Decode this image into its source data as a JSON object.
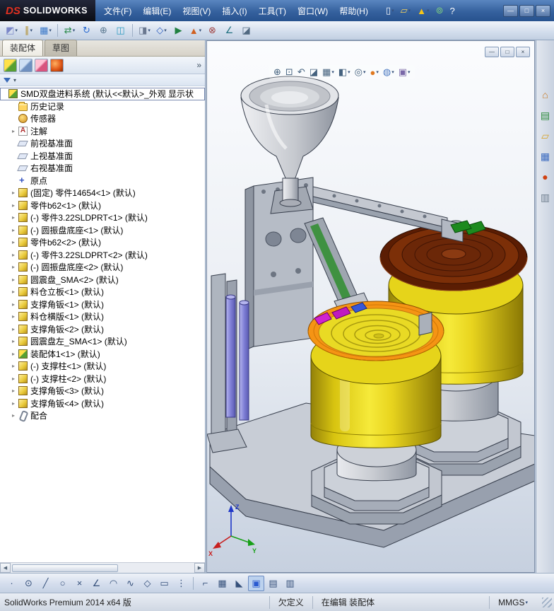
{
  "titlebar": {
    "brand_mark": "DS",
    "brand": "SOLIDWORKS",
    "menus": [
      {
        "label": "文件(F)"
      },
      {
        "label": "编辑(E)"
      },
      {
        "label": "视图(V)"
      },
      {
        "label": "插入(I)"
      },
      {
        "label": "工具(T)"
      },
      {
        "label": "窗口(W)"
      },
      {
        "label": "帮助(H)"
      }
    ],
    "tools": [
      {
        "name": "new-document-icon",
        "glyph": "▯",
        "color": "#f4f7fb",
        "arrow": true
      },
      {
        "name": "open-icon",
        "glyph": "▱",
        "color": "#f5d35c",
        "arrow": true
      },
      {
        "name": "alert-icon",
        "glyph": "▲",
        "color": "#f5c518",
        "arrow": true
      },
      {
        "name": "connect-icon",
        "glyph": "⊚",
        "color": "#7fd07f"
      },
      {
        "name": "help-icon",
        "glyph": "?",
        "color": "#ffffff"
      }
    ],
    "window_buttons": [
      {
        "name": "minimize-button",
        "glyph": "—"
      },
      {
        "name": "maximize-button",
        "glyph": "□"
      },
      {
        "name": "close-button",
        "glyph": "×"
      }
    ]
  },
  "toolbar": {
    "items": [
      {
        "name": "insert-component-icon",
        "glyph": "◩",
        "color": "#7a86c8",
        "arrow": true
      },
      {
        "name": "mate-icon",
        "glyph": "∥",
        "color": "#b08c28",
        "arrow": true
      },
      {
        "name": "linear-pattern-icon",
        "glyph": "▦",
        "color": "#3a78c8",
        "arrow": true
      },
      {
        "sep": true
      },
      {
        "name": "move-component-icon",
        "glyph": "⇄",
        "color": "#2a8a4a",
        "arrow": true
      },
      {
        "name": "rotate-component-icon",
        "glyph": "↻",
        "color": "#2a6ad0"
      },
      {
        "name": "smart-fasteners-icon",
        "glyph": "⊕",
        "color": "#5a7890"
      },
      {
        "name": "show-hidden-components-icon",
        "glyph": "◫",
        "color": "#2a9ac0"
      },
      {
        "sep": true
      },
      {
        "name": "assembly-features-icon",
        "glyph": "◨",
        "color": "#6a7890",
        "arrow": true
      },
      {
        "name": "reference-geometry-icon",
        "glyph": "◇",
        "color": "#3060c0",
        "arrow": true
      },
      {
        "name": "motion-study-icon",
        "glyph": "▶",
        "color": "#208040"
      },
      {
        "name": "exploded-view-icon",
        "glyph": "▲",
        "color": "#d06020",
        "arrow": true
      },
      {
        "name": "interference-detection-icon",
        "glyph": "⊗",
        "color": "#a04040"
      },
      {
        "name": "measure-icon",
        "glyph": "∠",
        "color": "#207080"
      },
      {
        "name": "section-view-icon",
        "glyph": "◪",
        "color": "#506880"
      }
    ]
  },
  "left_panel": {
    "tabs": [
      {
        "label": "装配体",
        "active": true
      },
      {
        "label": "草图"
      }
    ],
    "manager_tabs": [
      {
        "name": "featuremanager-tab",
        "icon": "fm"
      },
      {
        "name": "propertymanager-tab",
        "icon": "pm"
      },
      {
        "name": "configurationmanager-tab",
        "icon": "cm"
      },
      {
        "name": "displaymanager-tab",
        "icon": "dm"
      }
    ],
    "expand_glyph": "»",
    "filter_arrow": "▾",
    "scroll": {
      "left_glyph": "◀",
      "right_glyph": "▶"
    },
    "tree": [
      {
        "icon": "assembly",
        "label": "SMD双盘进料系统 (默认<<默认>_外观 显示状",
        "root": true,
        "boxed": true
      },
      {
        "icon": "folder",
        "label": "历史记录"
      },
      {
        "icon": "sensor",
        "label": "传感器"
      },
      {
        "icon": "annotation",
        "label": "注解",
        "expander": true
      },
      {
        "icon": "plane",
        "label": "前视基准面"
      },
      {
        "icon": "plane",
        "label": "上视基准面"
      },
      {
        "icon": "plane",
        "label": "右视基准面"
      },
      {
        "icon": "origin",
        "label": "原点"
      },
      {
        "icon": "part",
        "label": "(固定) 零件14654<1> (默认)",
        "expander": true
      },
      {
        "icon": "part",
        "label": "零件b62<1> (默认)",
        "expander": true
      },
      {
        "icon": "part",
        "label": "(-) 零件3.22SLDPRT<1> (默认)",
        "expander": true
      },
      {
        "icon": "part",
        "label": "(-) 圆振盘底座<1> (默认)",
        "expander": true
      },
      {
        "icon": "part",
        "label": "零件b62<2> (默认)",
        "expander": true
      },
      {
        "icon": "part",
        "label": "(-) 零件3.22SLDPRT<2> (默认)",
        "expander": true
      },
      {
        "icon": "part",
        "label": "(-) 圆振盘底座<2> (默认)",
        "expander": true
      },
      {
        "icon": "part",
        "label": "圆震盘_SMA<2> (默认)",
        "expander": true
      },
      {
        "icon": "part",
        "label": "料仓立板<1> (默认)",
        "expander": true
      },
      {
        "icon": "part",
        "label": "支撑角钣<1> (默认)",
        "expander": true
      },
      {
        "icon": "part",
        "label": "料仓横版<1> (默认)",
        "expander": true
      },
      {
        "icon": "part",
        "label": "支撑角钣<2> (默认)",
        "expander": true
      },
      {
        "icon": "part",
        "label": "圆震盘左_SMA<1> (默认)",
        "expander": true
      },
      {
        "icon": "assembly",
        "label": "装配体1<1> (默认)",
        "expander": true
      },
      {
        "icon": "part",
        "label": "(-) 支撑柱<1> (默认)",
        "expander": true
      },
      {
        "icon": "part",
        "label": "(-) 支撑柱<2> (默认)",
        "expander": true
      },
      {
        "icon": "part",
        "label": "支撑角钣<3> (默认)",
        "expander": true
      },
      {
        "icon": "part",
        "label": "支撑角钣<4> (默认)",
        "expander": true
      },
      {
        "icon": "mates",
        "label": "配合",
        "expander": true
      }
    ]
  },
  "viewport": {
    "hud": [
      {
        "name": "zoom-fit-icon",
        "glyph": "⊕"
      },
      {
        "name": "zoom-area-icon",
        "glyph": "⊡"
      },
      {
        "name": "previous-view-icon",
        "glyph": "↶"
      },
      {
        "name": "section-view-icon",
        "glyph": "◪"
      },
      {
        "name": "view-orientation-icon",
        "glyph": "▦",
        "arrow": true
      },
      {
        "name": "display-style-icon",
        "glyph": "◧",
        "arrow": true
      },
      {
        "name": "hide-show-items-icon",
        "glyph": "◎",
        "arrow": true
      },
      {
        "name": "edit-appearance-icon",
        "glyph": "●",
        "color": "#e07820",
        "arrow": true
      },
      {
        "name": "apply-scene-icon",
        "glyph": "◍",
        "color": "#4a78c0",
        "arrow": true
      },
      {
        "name": "view-settings-icon",
        "glyph": "▣",
        "color": "#7a68a8",
        "arrow": true
      }
    ],
    "doc_buttons": [
      {
        "name": "doc-minimize-button",
        "glyph": "—"
      },
      {
        "name": "doc-restore-button",
        "glyph": "□"
      },
      {
        "name": "doc-close-button",
        "glyph": "×"
      }
    ],
    "triad": {
      "x": "X",
      "y": "Y",
      "z": "Z"
    }
  },
  "taskpane": {
    "icons": [
      {
        "name": "resources-home-icon",
        "glyph": "⌂",
        "color": "#c87820"
      },
      {
        "name": "design-library-icon",
        "glyph": "▤",
        "color": "#2a8a3a"
      },
      {
        "name": "file-explorer-icon",
        "glyph": "▱",
        "color": "#d8a020"
      },
      {
        "name": "view-palette-icon",
        "glyph": "▦",
        "color": "#3a6ac0"
      },
      {
        "name": "appearances-icon",
        "glyph": "●",
        "color": "#d04010"
      },
      {
        "name": "custom-properties-icon",
        "glyph": "▥",
        "color": "#708090"
      }
    ]
  },
  "bottom_toolbar": {
    "items": [
      {
        "name": "point-icon",
        "glyph": "·"
      },
      {
        "name": "circle-icon",
        "glyph": "⊙"
      },
      {
        "name": "line-icon",
        "glyph": "╱"
      },
      {
        "name": "ellipse-icon",
        "glyph": "○"
      },
      {
        "name": "trim-entities-icon",
        "glyph": "×"
      },
      {
        "name": "smart-dimension-icon",
        "glyph": "∠"
      },
      {
        "name": "arc-icon",
        "glyph": "◠"
      },
      {
        "name": "spline-icon",
        "glyph": "∿"
      },
      {
        "name": "polygon-icon",
        "glyph": "◇"
      },
      {
        "name": "rectangle-icon",
        "glyph": "▭"
      },
      {
        "name": "more-sketch-tools-icon",
        "glyph": "⋮"
      },
      {
        "sep": true
      },
      {
        "name": "sketch-relations-icon",
        "glyph": "⌐"
      },
      {
        "name": "grid-snap-icon",
        "glyph": "▦"
      },
      {
        "name": "quick-snaps-icon",
        "glyph": "◣"
      },
      {
        "name": "shaded-sketch-icon",
        "glyph": "▣",
        "active": true,
        "color": "#2a5ad0"
      },
      {
        "name": "drawing-sheet-icon",
        "glyph": "▤"
      },
      {
        "name": "evaluate-icon",
        "glyph": "▥"
      }
    ]
  },
  "statusbar": {
    "app": "SolidWorks Premium 2014 x64 版",
    "definition_state": "欠定义",
    "edit_state": "在编辑 装配体",
    "units": "MMGS"
  }
}
